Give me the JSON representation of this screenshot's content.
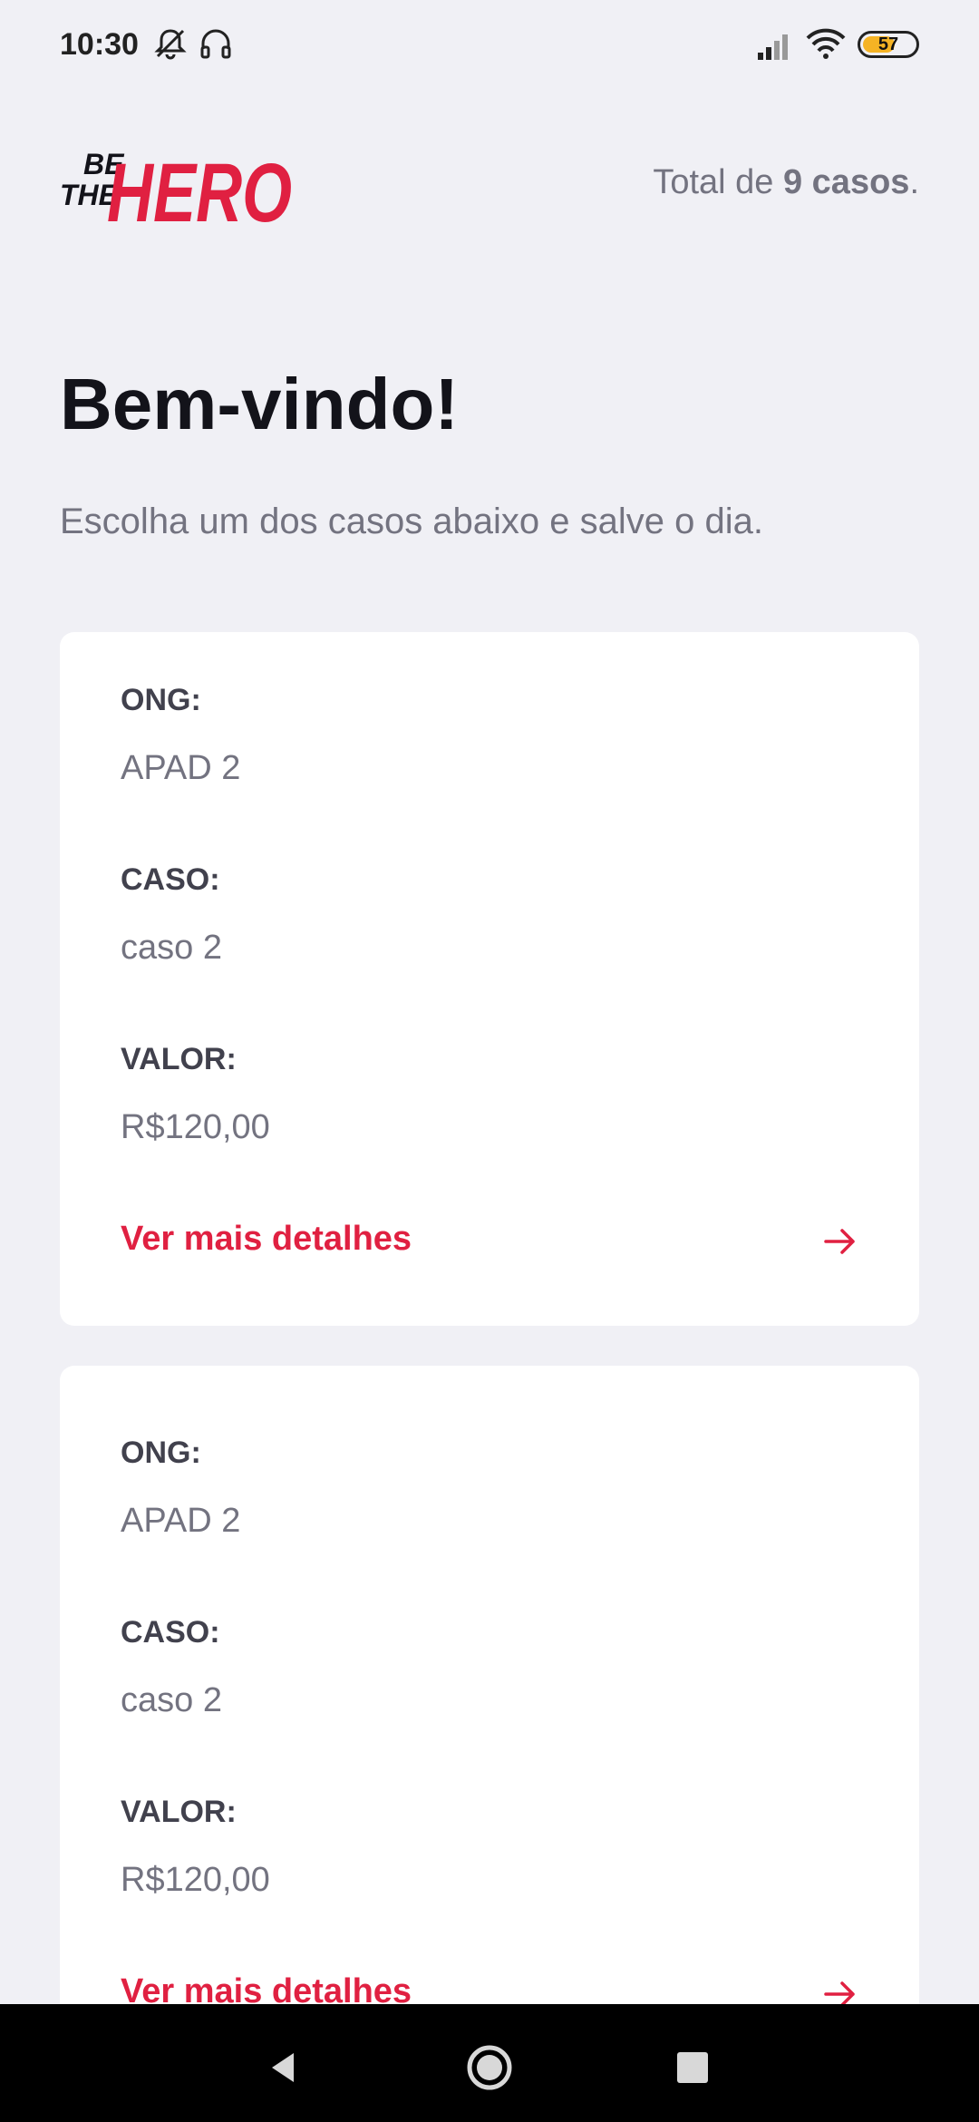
{
  "status_bar": {
    "time": "10:30",
    "battery": "57",
    "icons": [
      "mute-icon",
      "headset-icon",
      "signal-icon",
      "wifi-icon",
      "battery-icon"
    ]
  },
  "header": {
    "logo_text_small": [
      "BE",
      "THE"
    ],
    "logo_text_big": "HERO",
    "total_prefix": "Total de ",
    "total_count": "9 casos",
    "total_suffix": "."
  },
  "welcome": {
    "title": "Bem-vindo!",
    "subtitle": "Escolha um dos casos abaixo e salve o dia."
  },
  "cases": [
    {
      "ong_label": "ONG:",
      "ong_value": "APAD 2",
      "caso_label": "CASO:",
      "caso_value": "caso 2",
      "valor_label": "VALOR:",
      "valor_value": "R$120,00",
      "details_label": "Ver mais detalhes"
    },
    {
      "ong_label": "ONG:",
      "ong_value": "APAD 2",
      "caso_label": "CASO:",
      "caso_value": "caso 2",
      "valor_label": "VALOR:",
      "valor_value": "R$120,00",
      "details_label": "Ver mais detalhes"
    }
  ],
  "colors": {
    "accent": "#e02041",
    "background": "#f0f0f5",
    "title": "#13131a",
    "muted": "#737380"
  }
}
